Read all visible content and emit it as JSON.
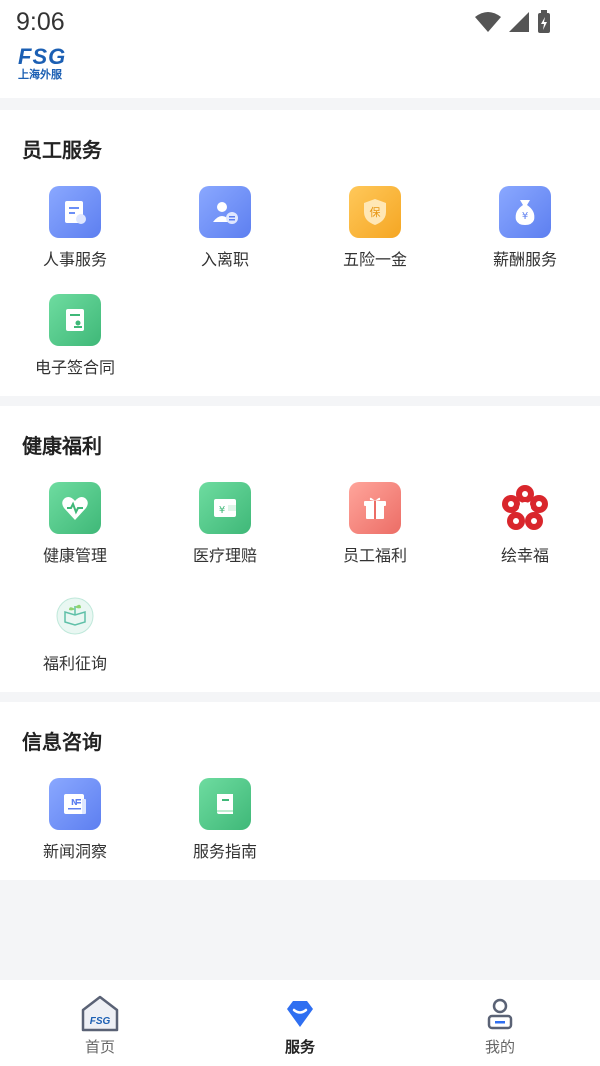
{
  "status": {
    "time": "9:06"
  },
  "brand": {
    "logo_text": "FSG",
    "logo_sub": "上海外服"
  },
  "sections": [
    {
      "title": "员工服务",
      "items": [
        {
          "label": "人事服务",
          "icon": "document-icon",
          "color": "#6b8ff7"
        },
        {
          "label": "入离职",
          "icon": "person-exchange-icon",
          "color": "#6b8ff7"
        },
        {
          "label": "五险一金",
          "icon": "shield-insurance-icon",
          "color": "#f5a623"
        },
        {
          "label": "薪酬服务",
          "icon": "money-bag-icon",
          "color": "#6b8ff7"
        },
        {
          "label": "电子签合同",
          "icon": "contract-icon",
          "color": "#4cc68a"
        }
      ]
    },
    {
      "title": "健康福利",
      "items": [
        {
          "label": "健康管理",
          "icon": "heart-pulse-icon",
          "color": "#4cc68a"
        },
        {
          "label": "医疗理赔",
          "icon": "wallet-icon",
          "color": "#4cc68a"
        },
        {
          "label": "员工福利",
          "icon": "gift-icon",
          "color": "#f0807a"
        },
        {
          "label": "绘幸福",
          "icon": "flower-logo-icon",
          "color": "#d9262c"
        },
        {
          "label": "福利征询",
          "icon": "plant-book-icon",
          "color": "#5fc0a8"
        }
      ]
    },
    {
      "title": "信息咨询",
      "items": [
        {
          "label": "新闻洞察",
          "icon": "newspaper-icon",
          "color": "#6b8ff7"
        },
        {
          "label": "服务指南",
          "icon": "book-icon",
          "color": "#4cc68a"
        }
      ]
    }
  ],
  "tabs": [
    {
      "label": "首页",
      "icon": "home-icon",
      "active": false
    },
    {
      "label": "服务",
      "icon": "diamond-icon",
      "active": true
    },
    {
      "label": "我的",
      "icon": "user-icon",
      "active": false
    }
  ]
}
